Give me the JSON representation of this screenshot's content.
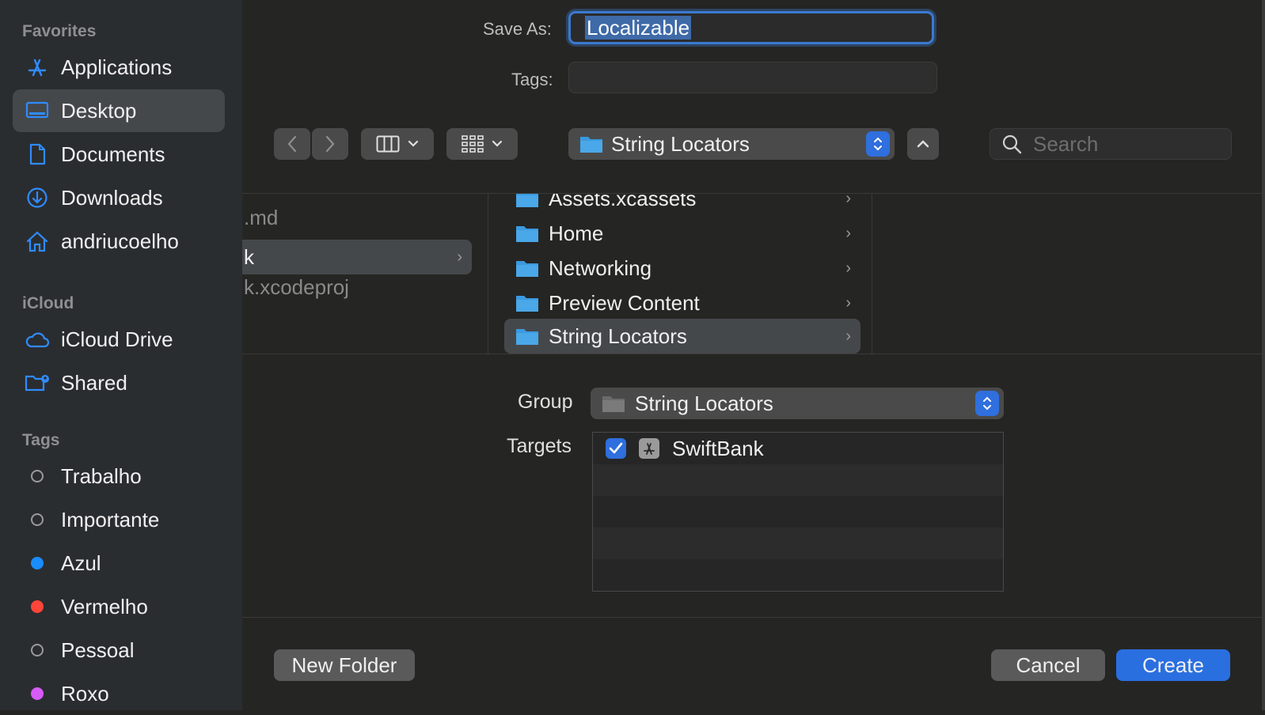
{
  "sidebar": {
    "favorites_header": "Favorites",
    "favorites": [
      {
        "label": "Applications",
        "icon": "applications-icon"
      },
      {
        "label": "Desktop",
        "icon": "desktop-icon",
        "selected": true
      },
      {
        "label": "Documents",
        "icon": "documents-icon"
      },
      {
        "label": "Downloads",
        "icon": "downloads-icon"
      },
      {
        "label": "andriucoelho",
        "icon": "home-icon"
      }
    ],
    "icloud_header": "iCloud",
    "icloud": [
      {
        "label": "iCloud Drive",
        "icon": "icloud-icon"
      },
      {
        "label": "Shared",
        "icon": "shared-folder-icon"
      }
    ],
    "tags_header": "Tags",
    "tags": [
      {
        "label": "Trabalho",
        "color": "none"
      },
      {
        "label": "Importante",
        "color": "none"
      },
      {
        "label": "Azul",
        "color": "#1a8cff"
      },
      {
        "label": "Vermelho",
        "color": "#ff453a"
      },
      {
        "label": "Pessoal",
        "color": "none"
      },
      {
        "label": "Roxo",
        "color": "#d65cf5"
      }
    ]
  },
  "form": {
    "save_as_label": "Save As:",
    "save_as_value": "Localizable",
    "tags_label": "Tags:",
    "tags_value": ""
  },
  "toolbar": {
    "path_label": "String Locators",
    "search_placeholder": "Search"
  },
  "browser": {
    "column1": [
      {
        "label": ".md"
      },
      {
        "label": "k",
        "selected": true
      },
      {
        "label": "k.xcodeproj"
      }
    ],
    "column2": [
      {
        "label": "Assets.xcassets"
      },
      {
        "label": "Home"
      },
      {
        "label": "Networking"
      },
      {
        "label": "Preview Content"
      },
      {
        "label": "String Locators",
        "selected": true
      }
    ]
  },
  "options": {
    "group_label": "Group",
    "group_value": "String Locators",
    "targets_label": "Targets",
    "targets": [
      {
        "label": "SwiftBank",
        "checked": true
      }
    ]
  },
  "buttons": {
    "new_folder": "New Folder",
    "cancel": "Cancel",
    "create": "Create"
  },
  "colors": {
    "accent": "#2a6fe0",
    "focus_ring": "#3b7ad1",
    "sidebar_icon": "#2f8cff",
    "folder": "#4aa7e8"
  }
}
